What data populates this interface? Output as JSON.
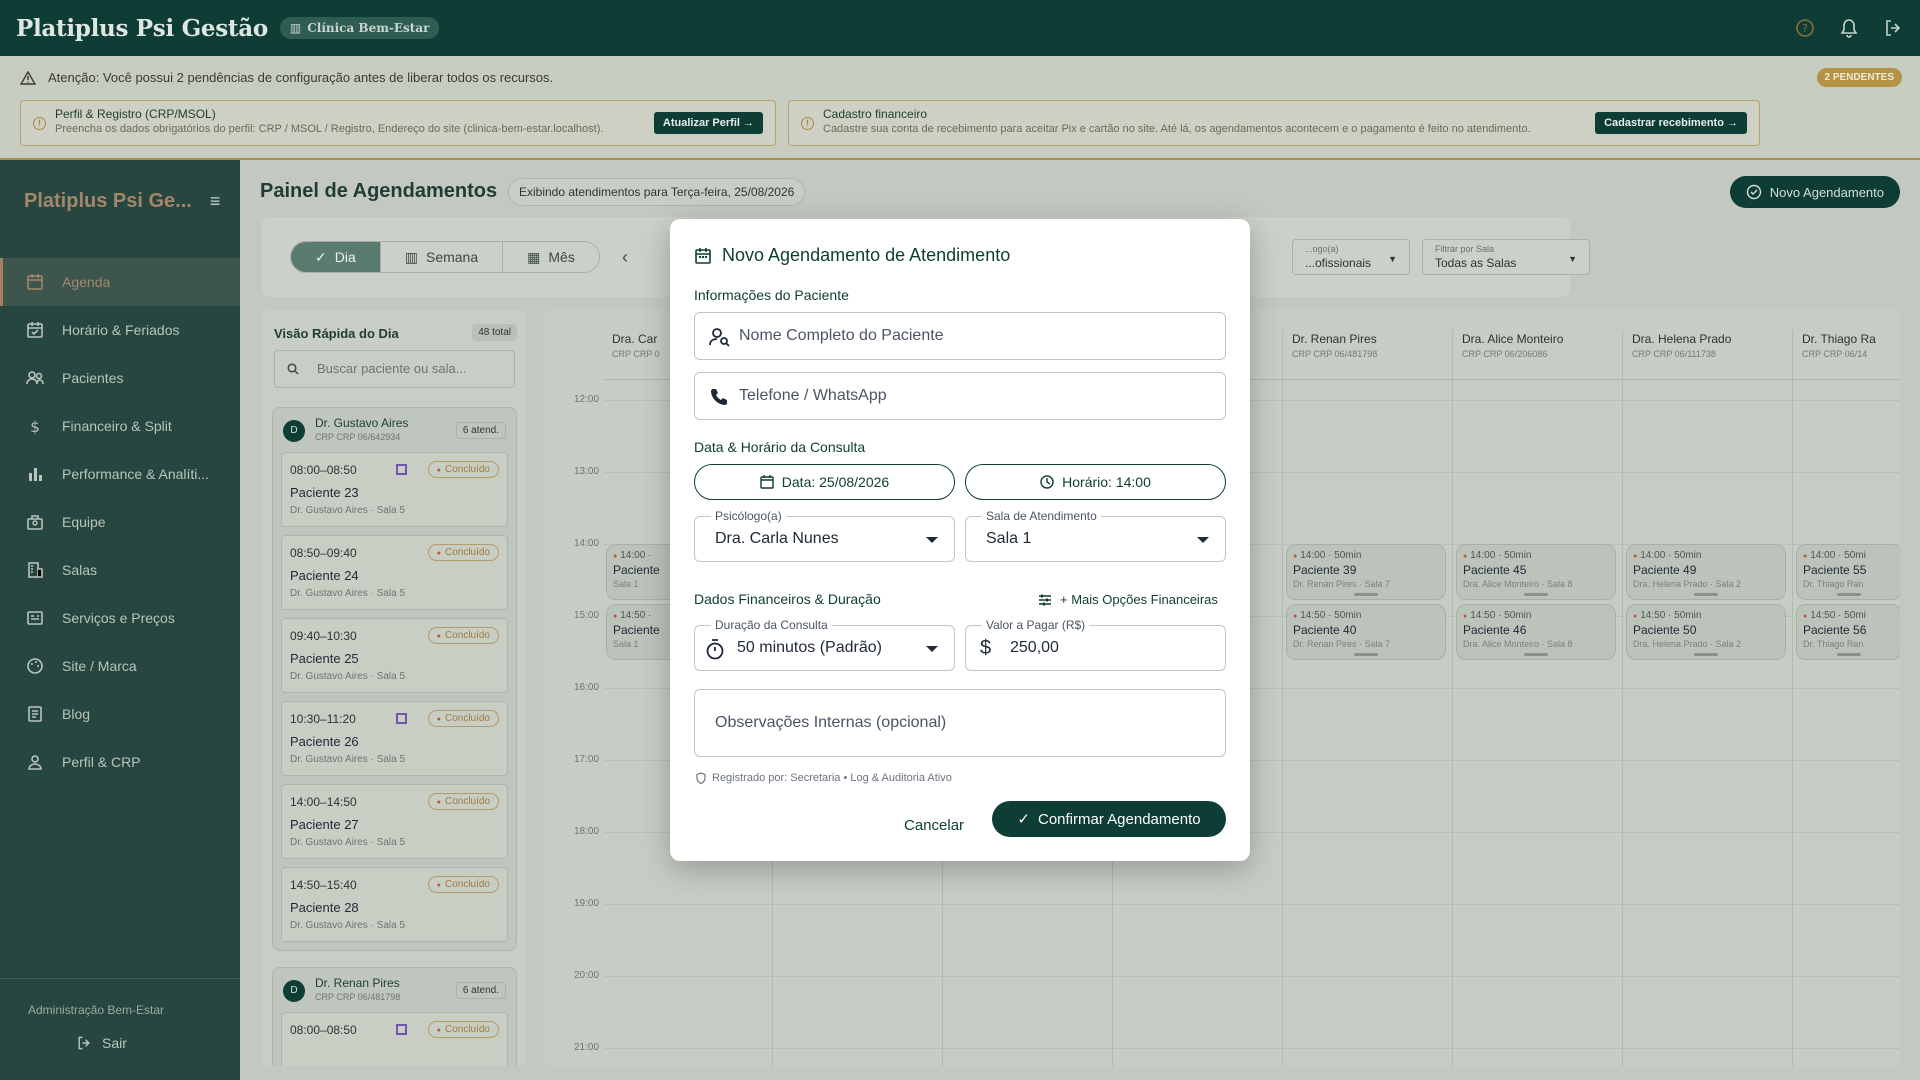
{
  "app": {
    "title": "Platiplus Psi Gestão",
    "clinic": "Clínica Bem-Estar"
  },
  "alerts": {
    "message": "Atenção: Você possui 2 pendências de configuração antes de liberar todos os recursos.",
    "badge": "2 PENDENTES",
    "cards": [
      {
        "title": "Perfil & Registro (CRP/MSOL)",
        "desc": "Preencha os dados obrigatórios do perfil: CRP / MSOL / Registro, Endereço do site (clinica-bem-estar.localhost).",
        "button": "Atualizar Perfil →"
      },
      {
        "title": "Cadastro financeiro",
        "desc": "Cadastre sua conta de recebimento para aceitar Pix e cartão no site. Até lá, os agendamentos acontecem e o pagamento é feito no atendimento.",
        "button": "Cadastrar recebimento →"
      }
    ]
  },
  "sidebar": {
    "brand": "Platiplus Psi Ge...",
    "items": [
      {
        "label": "Agenda",
        "icon": "calendar-icon"
      },
      {
        "label": "Horário & Feriados",
        "icon": "calendar-check-icon"
      },
      {
        "label": "Pacientes",
        "icon": "users-icon"
      },
      {
        "label": "Financeiro & Split",
        "icon": "dollar-icon"
      },
      {
        "label": "Performance & Analíti...",
        "icon": "bar-chart-icon"
      },
      {
        "label": "Equipe",
        "icon": "team-icon"
      },
      {
        "label": "Salas",
        "icon": "building-icon"
      },
      {
        "label": "Serviços e Preços",
        "icon": "tag-icon"
      },
      {
        "label": "Site / Marca",
        "icon": "palette-icon"
      },
      {
        "label": "Blog",
        "icon": "article-icon"
      },
      {
        "label": "Perfil & CRP",
        "icon": "profile-icon"
      }
    ],
    "admin": "Administração Bem-Estar",
    "logout": "Sair"
  },
  "page": {
    "title": "Painel de Agendamentos",
    "subtitle": "Exibindo atendimentos para Terça-feira, 25/08/2026",
    "new_button": "Novo Agendamento"
  },
  "toolbar": {
    "views": [
      "Dia",
      "Semana",
      "Mês"
    ],
    "filter_psych": {
      "label": "...ogo(a)",
      "value": "...ofissionais"
    },
    "filter_room": {
      "label": "Filtrar por Sala",
      "value": "Todas as Salas"
    }
  },
  "quick": {
    "title": "Visão Rápida do Dia",
    "total": "48 total",
    "search_placeholder": "Buscar paciente ou sala...",
    "groups": [
      {
        "avatar": "D",
        "name": "Dr. Gustavo Aires",
        "crp": "CRP CRP 06/642934",
        "count": "6 atend.",
        "items": [
          {
            "time": "08:00–08:50",
            "patient": "Paciente 23",
            "sub": "Dr. Gustavo Aires · Sala 5",
            "status": "Concluído",
            "qr": true
          },
          {
            "time": "08:50–09:40",
            "patient": "Paciente 24",
            "sub": "Dr. Gustavo Aires · Sala 5",
            "status": "Concluído",
            "qr": false
          },
          {
            "time": "09:40–10:30",
            "patient": "Paciente 25",
            "sub": "Dr. Gustavo Aires · Sala 5",
            "status": "Concluído",
            "qr": false
          },
          {
            "time": "10:30–11:20",
            "patient": "Paciente 26",
            "sub": "Dr. Gustavo Aires · Sala 5",
            "status": "Concluído",
            "qr": true
          },
          {
            "time": "14:00–14:50",
            "patient": "Paciente 27",
            "sub": "Dr. Gustavo Aires · Sala 5",
            "status": "Concluído",
            "qr": false
          },
          {
            "time": "14:50–15:40",
            "patient": "Paciente 28",
            "sub": "Dr. Gustavo Aires · Sala 5",
            "status": "Concluído",
            "qr": false
          }
        ]
      },
      {
        "avatar": "D",
        "name": "Dr. Renan Pires",
        "crp": "CRP CRP 06/481798",
        "count": "6 atend.",
        "items": [
          {
            "time": "08:00–08:50",
            "patient": "",
            "sub": "",
            "status": "Concluído",
            "qr": true
          }
        ]
      }
    ]
  },
  "calendar": {
    "hours": [
      "12:00",
      "13:00",
      "14:00",
      "15:00",
      "16:00",
      "17:00",
      "18:00",
      "19:00",
      "20:00",
      "21:00"
    ],
    "columns": [
      {
        "name": "Dra. Car",
        "crp": "CRP CRP 0"
      },
      {
        "name": "",
        "crp": ""
      },
      {
        "name": "",
        "crp": ""
      },
      {
        "name": "",
        "crp": ""
      },
      {
        "name": "Dr. Renan Pires",
        "crp": "CRP CRP 06/481798"
      },
      {
        "name": "Dra. Alice Monteiro",
        "crp": "CRP CRP 06/206086"
      },
      {
        "name": "Dra. Helena Prado",
        "crp": "CRP CRP 06/111738"
      },
      {
        "name": "Dr. Thiago Ra",
        "crp": "CRP CRP 06/14"
      }
    ],
    "events": [
      {
        "col": 0,
        "slot": 0,
        "time": "14:00 ·",
        "patient": "Paciente",
        "sub": "Sala 1"
      },
      {
        "col": 0,
        "slot": 1,
        "time": "14:50 ·",
        "patient": "Paciente",
        "sub": "Sala 1"
      },
      {
        "col": 4,
        "slot": 0,
        "time": "14:00 · 50min",
        "patient": "Paciente 39",
        "sub": "Dr. Renan Pires · Sala 7"
      },
      {
        "col": 4,
        "slot": 1,
        "time": "14:50 · 50min",
        "patient": "Paciente 40",
        "sub": "Dr. Renan Pires · Sala 7"
      },
      {
        "col": 5,
        "slot": 0,
        "time": "14:00 · 50min",
        "patient": "Paciente 45",
        "sub": "Dra. Alice Monteiro · Sala 8"
      },
      {
        "col": 5,
        "slot": 1,
        "time": "14:50 · 50min",
        "patient": "Paciente 46",
        "sub": "Dra. Alice Monteiro · Sala 8"
      },
      {
        "col": 6,
        "slot": 0,
        "time": "14:00 · 50min",
        "patient": "Paciente 49",
        "sub": "Dra. Helena Prado · Sala 2"
      },
      {
        "col": 6,
        "slot": 1,
        "time": "14:50 · 50min",
        "patient": "Paciente 50",
        "sub": "Dra. Helena Prado · Sala 2"
      },
      {
        "col": 7,
        "slot": 0,
        "time": "14:00 · 50mi",
        "patient": "Paciente 55",
        "sub": "Dr. Thiago Ran"
      },
      {
        "col": 7,
        "slot": 1,
        "time": "14:50 · 50mi",
        "patient": "Paciente 56",
        "sub": "Dr. Thiago Ran"
      }
    ]
  },
  "modal": {
    "title": "Novo Agendamento de Atendimento",
    "patient_section": "Informações do Paciente",
    "name_placeholder": "Nome Completo do Paciente",
    "phone_placeholder": "Telefone / WhatsApp",
    "datetime_section": "Data & Horário da Consulta",
    "date": "Data: 25/08/2026",
    "time": "Horário: 14:00",
    "psych_label": "Psicólogo(a)",
    "psych_value": "Dra. Carla Nunes",
    "room_label": "Sala de Atendimento",
    "room_value": "Sala 1",
    "finance_section": "Dados Financeiros & Duração",
    "more_finance": "+ Mais Opções Financeiras",
    "duration_label": "Duração da Consulta",
    "duration_value": "50 minutos (Padrão)",
    "price_label": "Valor a Pagar (R$)",
    "price_value": "250,00",
    "notes_placeholder": "Observações Internas (opcional)",
    "audit": "Registrado por: Secretaria • Log & Auditoria Ativo",
    "cancel": "Cancelar",
    "confirm": "Confirmar Agendamento"
  }
}
